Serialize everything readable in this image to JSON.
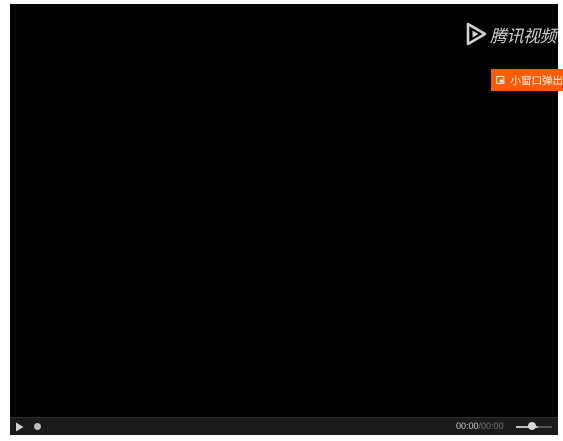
{
  "player": {
    "logo_text": "腾讯视频",
    "popout_label": "小窗口弹出",
    "time_current": "00:00",
    "time_separator": "/",
    "time_total": "00:00",
    "progress_fraction": 0,
    "volume_fraction": 0.55,
    "colors": {
      "video_background": "#000000",
      "popout_button": "#ff5c00",
      "control_bar": "#1b1b1b"
    },
    "icons": {
      "logo": "tencent-video-logo-icon",
      "popout": "popout-window-icon",
      "play": "play-icon"
    }
  }
}
